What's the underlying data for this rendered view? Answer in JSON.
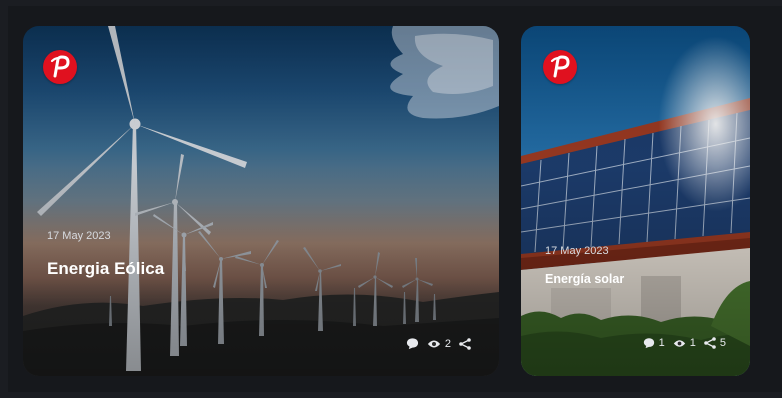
{
  "cards": [
    {
      "date": "17 May 2023",
      "title": "Energia Eólica",
      "stats": {
        "views": "2"
      },
      "logo_color": "#e0111f",
      "logo_letter": "P"
    },
    {
      "date": "17 May 2023",
      "title": "Energía solar",
      "stats": {
        "comments": "1",
        "views": "1",
        "shares": "5"
      },
      "logo_color": "#e0111f",
      "logo_letter": "P"
    }
  ],
  "icons": [
    "comment-icon",
    "eye-icon",
    "share-icon",
    "brand-logo-icon"
  ]
}
